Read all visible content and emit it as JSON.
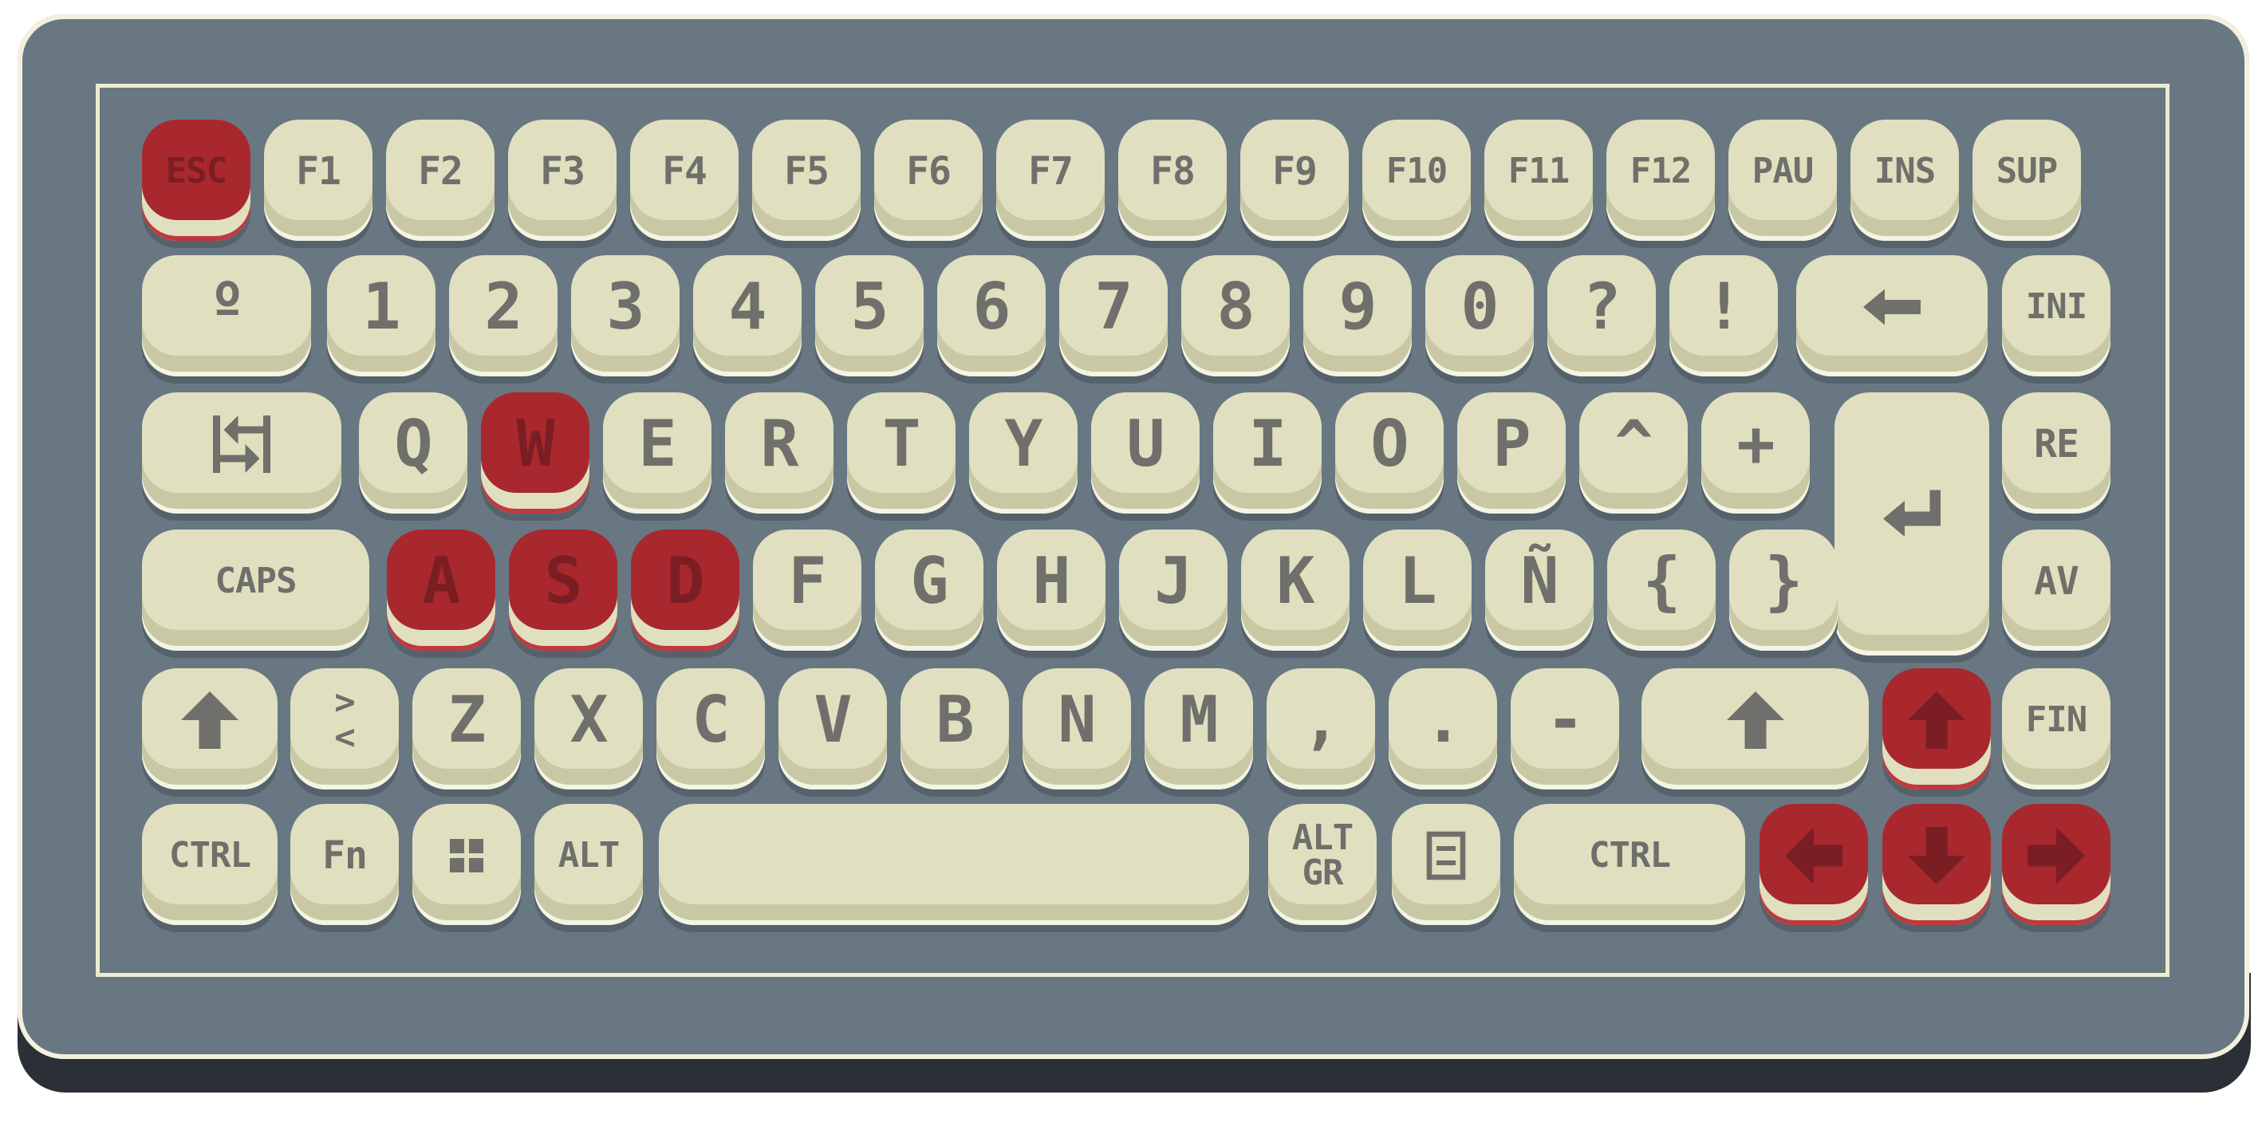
{
  "colors": {
    "case": "#687782",
    "case_shadow": "#2b3036",
    "frame": "#eeeccf",
    "key": "#e0e0c0",
    "key_shadow": "#c8c8a4",
    "key_red": "#a8282e",
    "legend": "#6f6f6b"
  },
  "rows": [
    [
      {
        "id": "esc",
        "label": "ESC",
        "red": true
      },
      {
        "id": "f1",
        "label": "F1"
      },
      {
        "id": "f2",
        "label": "F2"
      },
      {
        "id": "f3",
        "label": "F3"
      },
      {
        "id": "f4",
        "label": "F4"
      },
      {
        "id": "f5",
        "label": "F5"
      },
      {
        "id": "f6",
        "label": "F6"
      },
      {
        "id": "f7",
        "label": "F7"
      },
      {
        "id": "f8",
        "label": "F8"
      },
      {
        "id": "f9",
        "label": "F9"
      },
      {
        "id": "f10",
        "label": "F10"
      },
      {
        "id": "f11",
        "label": "F11"
      },
      {
        "id": "f12",
        "label": "F12"
      },
      {
        "id": "pau",
        "label": "PAU"
      },
      {
        "id": "ins",
        "label": "INS"
      },
      {
        "id": "sup",
        "label": "SUP"
      }
    ],
    [
      {
        "id": "ordinal",
        "label": "º"
      },
      {
        "id": "1",
        "label": "1"
      },
      {
        "id": "2",
        "label": "2"
      },
      {
        "id": "3",
        "label": "3"
      },
      {
        "id": "4",
        "label": "4"
      },
      {
        "id": "5",
        "label": "5"
      },
      {
        "id": "6",
        "label": "6"
      },
      {
        "id": "7",
        "label": "7"
      },
      {
        "id": "8",
        "label": "8"
      },
      {
        "id": "9",
        "label": "9"
      },
      {
        "id": "0",
        "label": "0"
      },
      {
        "id": "question",
        "label": "?"
      },
      {
        "id": "exclaim",
        "label": "!"
      },
      {
        "id": "backspace",
        "label": "",
        "icon": "backspace-arrow-icon"
      },
      {
        "id": "ini",
        "label": "INI"
      }
    ],
    [
      {
        "id": "tab",
        "label": "",
        "icon": "tab-arrows-icon"
      },
      {
        "id": "q",
        "label": "Q"
      },
      {
        "id": "w",
        "label": "W",
        "red": true
      },
      {
        "id": "e",
        "label": "E"
      },
      {
        "id": "r",
        "label": "R"
      },
      {
        "id": "t",
        "label": "T"
      },
      {
        "id": "y",
        "label": "Y"
      },
      {
        "id": "u",
        "label": "U"
      },
      {
        "id": "i",
        "label": "I"
      },
      {
        "id": "o",
        "label": "O"
      },
      {
        "id": "p",
        "label": "P"
      },
      {
        "id": "caret",
        "label": "^"
      },
      {
        "id": "plus",
        "label": "+"
      },
      {
        "id": "enter",
        "label": "",
        "icon": "enter-arrow-icon"
      },
      {
        "id": "re",
        "label": "RE"
      }
    ],
    [
      {
        "id": "caps",
        "label": "CAPS"
      },
      {
        "id": "a",
        "label": "A",
        "red": true
      },
      {
        "id": "s",
        "label": "S",
        "red": true
      },
      {
        "id": "d",
        "label": "D",
        "red": true
      },
      {
        "id": "f",
        "label": "F"
      },
      {
        "id": "g",
        "label": "G"
      },
      {
        "id": "h",
        "label": "H"
      },
      {
        "id": "j",
        "label": "J"
      },
      {
        "id": "k",
        "label": "K"
      },
      {
        "id": "l",
        "label": "L"
      },
      {
        "id": "enye",
        "label": "Ñ"
      },
      {
        "id": "lbrace",
        "label": "{"
      },
      {
        "id": "rbrace",
        "label": "}"
      },
      {
        "id": "av",
        "label": "AV"
      }
    ],
    [
      {
        "id": "lshift",
        "label": "",
        "icon": "shift-arrow-icon"
      },
      {
        "id": "angle",
        "label": ">\n<"
      },
      {
        "id": "z",
        "label": "Z"
      },
      {
        "id": "x",
        "label": "X"
      },
      {
        "id": "c",
        "label": "C"
      },
      {
        "id": "v",
        "label": "V"
      },
      {
        "id": "b",
        "label": "B"
      },
      {
        "id": "n",
        "label": "N"
      },
      {
        "id": "m",
        "label": "M"
      },
      {
        "id": "comma",
        "label": ","
      },
      {
        "id": "period",
        "label": "."
      },
      {
        "id": "minus",
        "label": "-"
      },
      {
        "id": "rshift",
        "label": "",
        "icon": "shift-arrow-icon"
      },
      {
        "id": "up",
        "label": "",
        "icon": "up-arrow-icon",
        "red": true
      },
      {
        "id": "fin",
        "label": "FIN"
      }
    ],
    [
      {
        "id": "lctrl",
        "label": "CTRL"
      },
      {
        "id": "fn",
        "label": "Fn"
      },
      {
        "id": "win",
        "label": "",
        "icon": "windows-grid-icon"
      },
      {
        "id": "alt",
        "label": "ALT"
      },
      {
        "id": "space",
        "label": ""
      },
      {
        "id": "altgr",
        "label": "ALT\nGR"
      },
      {
        "id": "menu",
        "label": "",
        "icon": "menu-icon"
      },
      {
        "id": "rctrl",
        "label": "CTRL"
      },
      {
        "id": "left",
        "label": "",
        "icon": "left-arrow-icon",
        "red": true
      },
      {
        "id": "down",
        "label": "",
        "icon": "down-arrow-icon",
        "red": true
      },
      {
        "id": "right",
        "label": "",
        "icon": "right-arrow-icon",
        "red": true
      }
    ]
  ]
}
